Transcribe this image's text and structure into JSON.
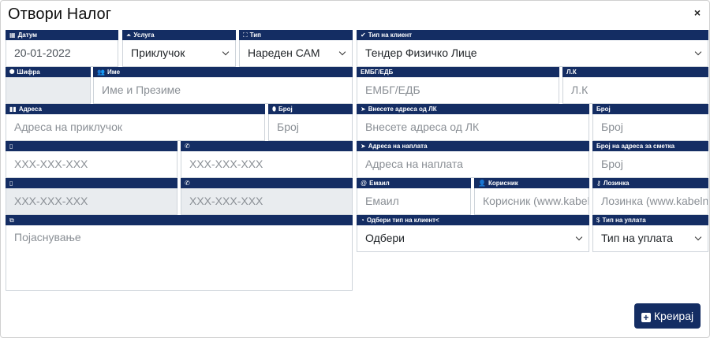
{
  "modal": {
    "title": "Отвори Налог",
    "close": "×"
  },
  "icons": {
    "date": "▦",
    "service": "⏶",
    "type": "⛶",
    "check": "✔",
    "tag": "⯃",
    "user": "👥",
    "building": "▮▮",
    "pin": "⬮",
    "arrow": "➤",
    "mobile": "▯",
    "phone": "✆",
    "at": "@",
    "useradd": "👤",
    "key": "⚷",
    "book": "⧉",
    "globe": "◔",
    "dollar": "$"
  },
  "fields": {
    "date": {
      "label": "Датум",
      "value": "20-01-2022"
    },
    "service": {
      "label": "Услуга",
      "value": "Приклучок"
    },
    "type": {
      "label": "Тип",
      "value": "Нареден САМ"
    },
    "client_type": {
      "label": "Тип на клиент",
      "value": "Тендер Физичко Лице"
    },
    "code": {
      "label": "Шифра",
      "value": ""
    },
    "name": {
      "label": "Име",
      "placeholder": "Име и Презиме"
    },
    "embg": {
      "label": "ЕМБГ/ЕДБ",
      "placeholder": "ЕМБГ/ЕДБ"
    },
    "lk": {
      "label": "Л.К",
      "placeholder": "Л.К"
    },
    "address": {
      "label": "Адреса",
      "placeholder": "Адреса на приклучок"
    },
    "number": {
      "label": "Број",
      "placeholder": "Број"
    },
    "lk_address": {
      "label": "Внесете адреса од ЛК",
      "placeholder": "Внесете адреса од ЛК"
    },
    "lk_number": {
      "label": "Број",
      "placeholder": "Број"
    },
    "mobile1": {
      "label": "",
      "placeholder": "XXX-XXX-XXX"
    },
    "phone1": {
      "label": "",
      "placeholder": "XXX-XXX-XXX"
    },
    "billing_address": {
      "label": "Адреса на наплата",
      "placeholder": "Адреса на наплата"
    },
    "billing_number": {
      "label": "Број на адреса за сметка",
      "placeholder": "Број"
    },
    "mobile2": {
      "label": "",
      "placeholder": "XXX-XXX-XXX"
    },
    "phone2": {
      "label": "",
      "placeholder": "XXX-XXX-XXX"
    },
    "email": {
      "label": "Емаил",
      "placeholder": "Емаил"
    },
    "username": {
      "label": "Корисник",
      "placeholder": "Корисник (www.kabelnet.mk)"
    },
    "password": {
      "label": "Лозинка",
      "placeholder": "Лозинка (www.kabelnet.mk)"
    },
    "notes": {
      "label": "",
      "placeholder": "Појаснување"
    },
    "select_client_type": {
      "label": "Одбери тип на клиент<",
      "value": "Одбери"
    },
    "payment_type": {
      "label": "Тип на уплата",
      "value": "Тип на уплата"
    }
  },
  "buttons": {
    "create": "Креирај"
  }
}
